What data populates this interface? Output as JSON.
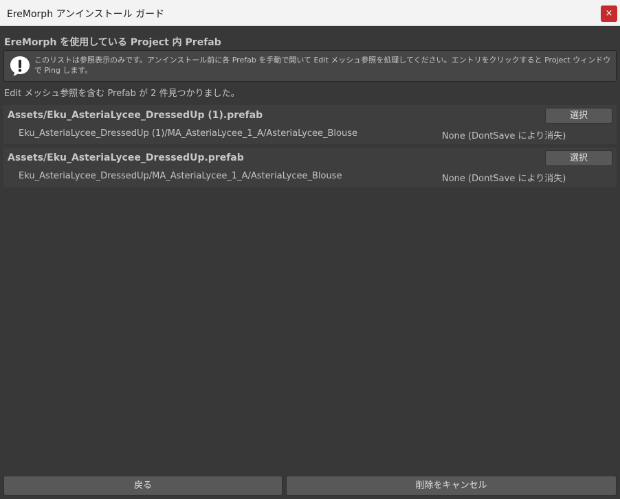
{
  "window": {
    "title": "EreMorph アンインストール ガード",
    "close_glyph": "×"
  },
  "section_title": "EreMorph を使用している Project 内 Prefab",
  "help": {
    "icon": "info-exclamation-icon",
    "text": "このリストは参照表示のみです。アンインストール前に各 Prefab を手動で開いて Edit メッシュ参照を処理してください。エントリをクリックすると Project ウィンドウで Ping します。"
  },
  "found_count_text": "Edit メッシュ参照を含む Prefab が 2 件見つかりました。",
  "prefabs": [
    {
      "path": "Assets/Eku_AsteriaLycee_DressedUp (1).prefab",
      "select_label": "選択",
      "mesh_path": "Eku_AsteriaLycee_DressedUp (1)/MA_AsteriaLycee_1_A/AsteriaLycee_Blouse",
      "status": "None (DontSave により消失)"
    },
    {
      "path": "Assets/Eku_AsteriaLycee_DressedUp.prefab",
      "select_label": "選択",
      "mesh_path": "Eku_AsteriaLycee_DressedUp/MA_AsteriaLycee_1_A/AsteriaLycee_Blouse",
      "status": "None (DontSave により消失)"
    }
  ],
  "footer": {
    "back_label": "戻る",
    "cancel_label": "削除をキャンセル"
  },
  "colors": {
    "background": "#383838",
    "titlebar": "#f3f3f3",
    "close": "#c42b2b",
    "button": "#585858",
    "text": "#c4c4c4"
  }
}
